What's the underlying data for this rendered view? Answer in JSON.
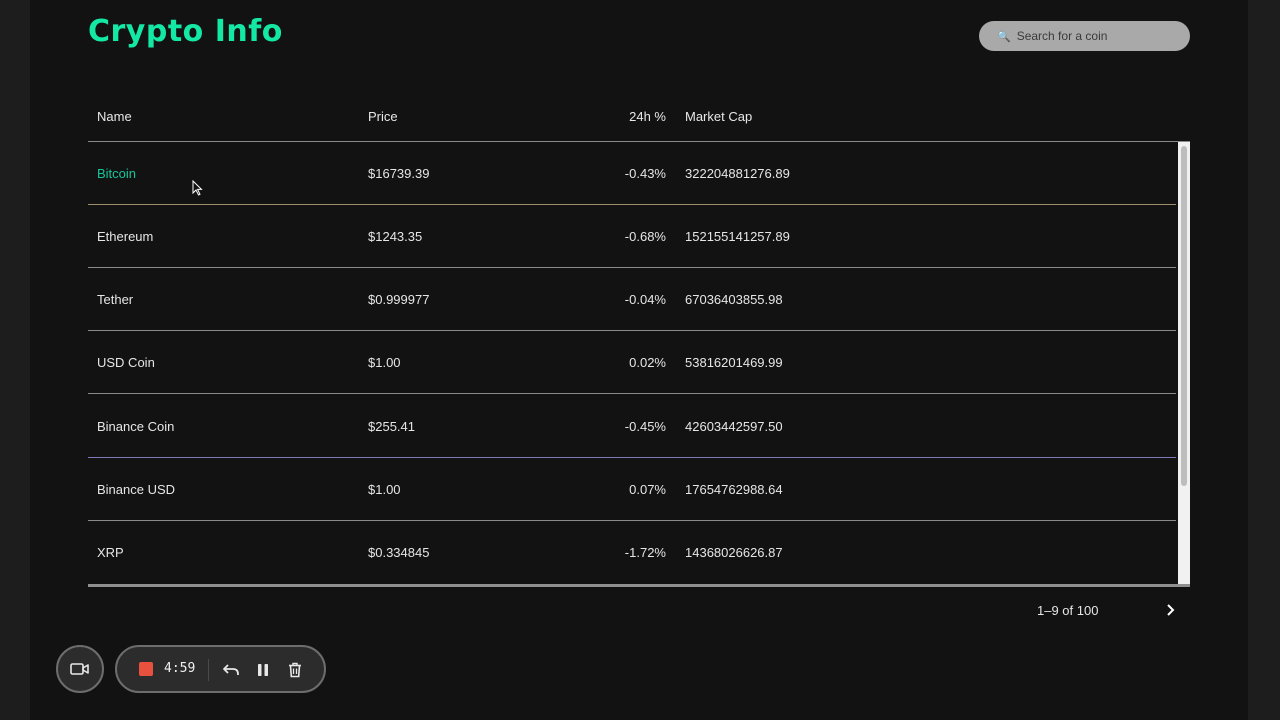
{
  "app": {
    "title": "Crypto Info"
  },
  "search": {
    "placeholder": "Search for a coin",
    "icon": "search-icon"
  },
  "table": {
    "headers": {
      "name": "Name",
      "price": "Price",
      "change": "24h %",
      "market_cap": "Market Cap"
    },
    "rows": [
      {
        "name": "Bitcoin",
        "price": "$16739.39",
        "change": "-0.43%",
        "market_cap": "322204881276.89"
      },
      {
        "name": "Ethereum",
        "price": "$1243.35",
        "change": "-0.68%",
        "market_cap": "152155141257.89"
      },
      {
        "name": "Tether",
        "price": "$0.999977",
        "change": "-0.04%",
        "market_cap": "67036403855.98"
      },
      {
        "name": "USD Coin",
        "price": "$1.00",
        "change": "0.02%",
        "market_cap": "53816201469.99"
      },
      {
        "name": "Binance Coin",
        "price": "$255.41",
        "change": "-0.45%",
        "market_cap": "42603442597.50"
      },
      {
        "name": "Binance USD",
        "price": "$1.00",
        "change": "0.07%",
        "market_cap": "17654762988.64"
      },
      {
        "name": "XRP",
        "price": "$0.334845",
        "change": "-1.72%",
        "market_cap": "14368026626.87"
      }
    ]
  },
  "pagination": {
    "label": "1–9 of 100",
    "next_icon": "chevron-right-icon"
  },
  "recorder": {
    "time": "4:59"
  },
  "colors": {
    "accent": "#14e8a5",
    "link": "#16c79a",
    "stop": "#e8513d"
  }
}
